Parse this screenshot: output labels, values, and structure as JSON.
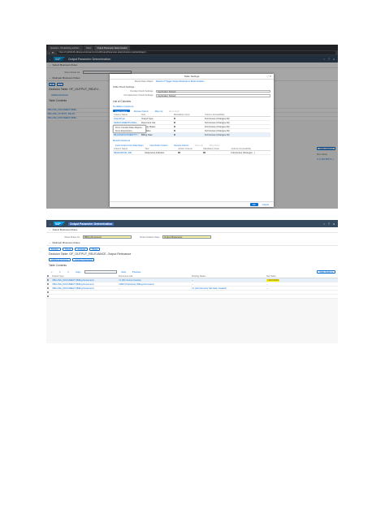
{
  "shot1": {
    "browser_tabs": [
      "Question - Predefining and Err...",
      "Inbox",
      "Output Parameter Determination"
    ],
    "url": "https://my301146.s4hana.ondemand.com/ui#OutputParameter-determination-maintain&/app=...",
    "app_title": "Output Parameter Determination",
    "sections": {
      "select": "Select Business Rules",
      "maintain": "Maintain Business Rules"
    },
    "show_rules_for_label": "Show Rules for:",
    "decision_table": "Decision Table: OF_OUTPUT_RELEV...",
    "additional_actions": "Additional Actions",
    "table_contents": "Table Contents",
    "bg_rows": [
      "=BILLING_DOCUMENT (Billin...",
      "=BILLING_OUTPUT_BILLIN...",
      "=BILLING_DOCUMENT (Billin..."
    ],
    "bg_right": {
      "table_settings": "Table Settings",
      "ref_value": "Ref Value",
      "output_value": "X (=OUTPUT...)"
    },
    "dialog": {
      "title": "Table Settings",
      "result_data_object_label": "Result Data Object:",
      "result_data_object_value": "Result of Trigger Output Relevance Determination",
      "table_check_settings": "Table Check Settings",
      "overlap_label": "Overlap Check Settings:",
      "overlap_value": "Application Default",
      "completeness_label": "Completeness Check Settings:",
      "completeness_value": "Application Default",
      "list_of_columns": "List of Columns",
      "condition_columns": "Condition Columns",
      "cond_buttons": [
        "Insert Column",
        "Remove Column",
        "Move Up",
        "Move Down"
      ],
      "dropdown_items": [
        "From Context Data Objects...",
        "From Expression..."
      ],
      "cond_headers": [
        "Column Name",
        "Text",
        "Mandatory Input",
        "Column Accessibility"
      ],
      "cond_rows": [
        {
          "name": "OutputType",
          "text": "Output Type",
          "access": "Full Access (Changes All)"
        },
        {
          "name": "SDDOCUMENTCATEG...",
          "text": "Document Cat.",
          "access": "Full Access (Changes All)"
        },
        {
          "name": "BLOCKINGREASONF...",
          "text": "Posting Status",
          "access": "Full Access (Changes All)"
        },
        {
          "name": "TOTALNETAMOUNT",
          "text": "Net Value",
          "access": "Full Access (Changes All)"
        },
        {
          "name": "BILLINGDOCUMENTTY...",
          "text": "Billing Date",
          "access": "Full Access (Changes All)"
        }
      ],
      "result_columns": "Result Columns",
      "result_buttons": [
        "Insert Column From Data Object",
        "Insert Action Column",
        "Remove Column",
        "Move Up",
        "Move Down"
      ],
      "result_headers": [
        "Column Name",
        "Text",
        "Action Column",
        "Mandatory Input",
        "Column Accessibility"
      ],
      "result_rows": [
        {
          "name": "RELEVANCE_IND",
          "text": "Relevance Indicator",
          "access": "Full Access (Changes...)"
        }
      ],
      "ok": "OK",
      "cancel": "Cancel"
    }
  },
  "shot2": {
    "app_title": "Output Parameter Determination",
    "sections": {
      "select": "Select Business Rules",
      "maintain": "Maintain Business Rules"
    },
    "show_rules_for_label": "Show Rules for:",
    "show_rules_for_value": "Billing Document",
    "determination_step_label": "Determination Step:",
    "determination_step_value": "Output Relevance",
    "toolbar": [
      "Display",
      "Check",
      "Activate",
      "Share"
    ],
    "decision_table": "Decision Table: OF_OUTPUT_RELEVANCE, Output Relevance",
    "additional_actions": "Additional Actions",
    "context_overview": "Context Overview",
    "table_contents": "Table Contents",
    "table_toolbar": [
      "Copy",
      "Next",
      "Previous",
      "Table Settings"
    ],
    "headers": [
      "Output Type",
      "Document Cat.",
      "Posting Status",
      "Net Value"
    ],
    "rows": [
      {
        "output_type": "=BILLING_DOCUMENT (Billing Document)",
        "doc_cat": "=1 (Pro Forma Invoice)",
        "posting": "",
        "net": "=XXXXXXX"
      },
      {
        "output_type": "=BILLING_DOCUMENT (Billing Document)",
        "doc_cat": "=M00 (Preliminary Billing Document)",
        "posting": "",
        "net": ""
      },
      {
        "output_type": "=BILLING_DOCUMENT (Billing Document)",
        "doc_cat": "",
        "posting": "=1 (Journal entry has been created)",
        "net": ""
      }
    ],
    "placeholder_cell": "--"
  }
}
